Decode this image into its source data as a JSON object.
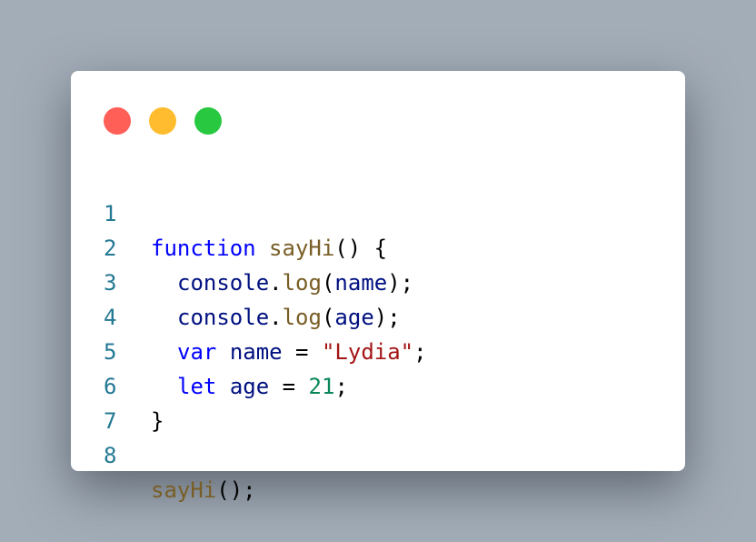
{
  "window": {
    "controls": [
      {
        "name": "close",
        "color": "#ff5f57"
      },
      {
        "name": "minimize",
        "color": "#febc2e"
      },
      {
        "name": "maximize",
        "color": "#28c840"
      }
    ]
  },
  "code": {
    "language": "javascript",
    "lines": [
      {
        "number": "1",
        "tokens": [
          "function",
          " ",
          "sayHi",
          "()",
          " {"
        ]
      },
      {
        "number": "2",
        "tokens": [
          "console",
          ".",
          "log",
          "(",
          "name",
          ");"
        ]
      },
      {
        "number": "3",
        "tokens": [
          "console",
          ".",
          "log",
          "(",
          "age",
          ");"
        ]
      },
      {
        "number": "4",
        "tokens": [
          "var",
          " ",
          "name",
          " = ",
          "\"Lydia\"",
          ";"
        ]
      },
      {
        "number": "5",
        "tokens": [
          "let",
          " ",
          "age",
          " = ",
          "21",
          ";"
        ]
      },
      {
        "number": "6",
        "tokens": [
          "}"
        ]
      },
      {
        "number": "7",
        "tokens": []
      },
      {
        "number": "8",
        "tokens": [
          "sayHi",
          "();"
        ]
      }
    ]
  },
  "colors": {
    "background": "#a3adb8",
    "window": "#ffffff",
    "line_number": "#237893",
    "keyword": "#0000ff",
    "function": "#795e26",
    "variable": "#001080",
    "string": "#a31515",
    "number": "#098658"
  }
}
